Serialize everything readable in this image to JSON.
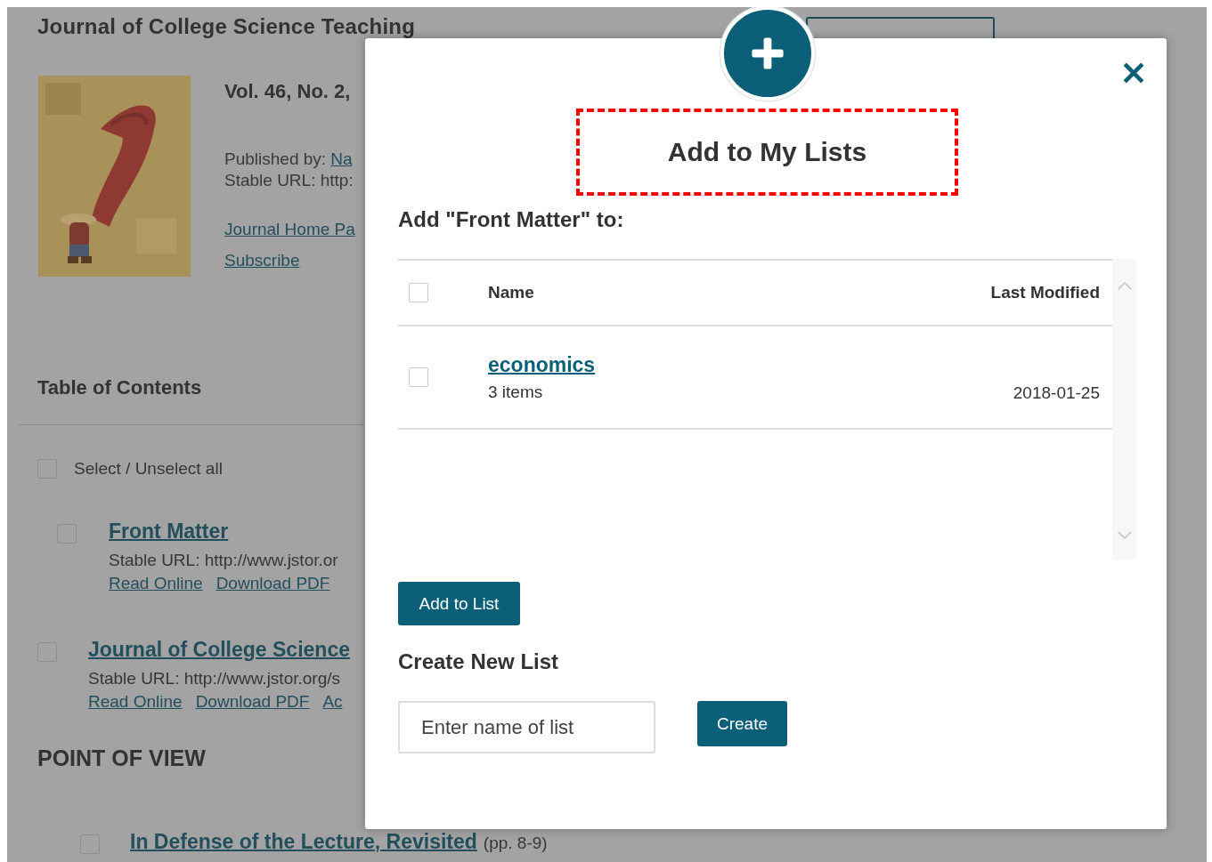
{
  "page": {
    "journal_title": "Journal of College Science Teaching",
    "issue": "Vol. 46, No. 2,",
    "published_by": {
      "label": "Published by:",
      "link": "Na"
    },
    "stable_url": "Stable URL: http:",
    "links": [
      "Journal Home Pa",
      "Subscribe"
    ],
    "toc": {
      "heading": "Table of Contents",
      "select_all": {
        "label": "Select / Unselect all",
        "checked": false
      },
      "entries": [
        {
          "kind": "indented",
          "title": "Front Matter",
          "checked": false,
          "url": "Stable URL: http://www.jstor.or",
          "actions": [
            "Read Online",
            "Download PDF"
          ]
        },
        {
          "kind": "top",
          "title": "Journal of College Science",
          "checked": false,
          "url": "Stable URL: http://www.jstor.org/s",
          "actions": [
            "Read Online",
            "Download PDF",
            "Ac"
          ]
        }
      ],
      "section": {
        "heading": "POINT OF VIEW",
        "entries": [
          {
            "title": "In Defense of the Lecture, Revisited",
            "pages": "(pp. 8-9)",
            "checked": false
          }
        ]
      }
    }
  },
  "modal": {
    "title": "Add to My Lists",
    "title_highlighted": true,
    "subtitle": "Add \"Front Matter\" to:",
    "table": {
      "columns": [
        "Name",
        "Last Modified"
      ],
      "select_all_checked": false,
      "rows": [
        {
          "name": "economics",
          "count": "3 items",
          "modified": "2018-01-25",
          "checked": false
        }
      ]
    },
    "add_button": "Add to List",
    "create": {
      "heading": "Create New List",
      "placeholder": "Enter name of list",
      "button": "Create"
    }
  }
}
